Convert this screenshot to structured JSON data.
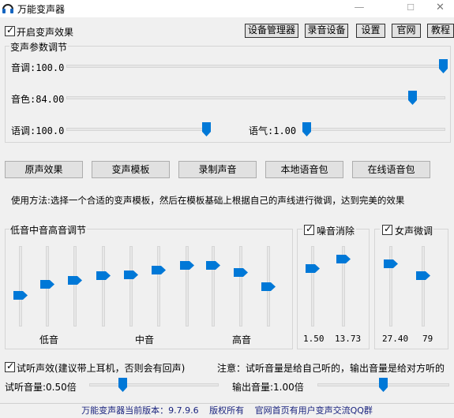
{
  "window": {
    "title": "万能变声器",
    "min": "—",
    "max": "☐",
    "close": "✕"
  },
  "enable_effect": {
    "label": "开启变声效果",
    "checked": true
  },
  "top_buttons": [
    "设备管理器",
    "录音设备",
    "设置",
    "官网",
    "教程"
  ],
  "params_group": {
    "title": "变声参数调节",
    "pitch": {
      "label": "音调:100.0",
      "value": 100.0
    },
    "timbre": {
      "label": "音色:84.00",
      "value": 84.0
    },
    "tone": {
      "label": "语调:100.0",
      "value": 100.0
    },
    "breath": {
      "label": "语气:1.00",
      "value": 1.0
    }
  },
  "action_buttons": [
    "原声效果",
    "变声模板",
    "录制声音",
    "本地语音包",
    "在线语音包"
  ],
  "usage_text": "使用方法:选择一个合适的变声模板，然后在模板基础上根据自己的声线进行微调，达到完美的效果",
  "eq_group": {
    "title": "低音中音高音调节",
    "labels": {
      "low": "低音",
      "mid": "中音",
      "high": "高音"
    },
    "band_levels": [
      0.39,
      0.52,
      0.57,
      0.63,
      0.64,
      0.7,
      0.76,
      0.76,
      0.67,
      0.5
    ]
  },
  "noise_group": {
    "label": "噪音消除",
    "checked": true,
    "values": [
      "1.50",
      "13.73"
    ],
    "levels": [
      0.72,
      0.84
    ]
  },
  "female_group": {
    "label": "女声微调",
    "checked": true,
    "values": [
      "27.40",
      "79"
    ],
    "levels": [
      0.78,
      0.63
    ]
  },
  "preview": {
    "label": "试听声效(建议带上耳机，否则会有回声)",
    "checked": true
  },
  "note": "注意：试听音量是给自己听的，输出音量是给对方听的",
  "preview_volume": {
    "label": "试听音量:0.50倍",
    "value": 0.5
  },
  "output_volume": {
    "label": "输出音量:1.00倍",
    "value": 1.0
  },
  "footer": {
    "version": "万能变声器当前版本：9.7.9.6",
    "copyright": "版权所有",
    "site_note": "官网首页有用户变声交流QQ群"
  },
  "colors": {
    "accent": "#0078d7",
    "footer_text": "#1a237e"
  }
}
